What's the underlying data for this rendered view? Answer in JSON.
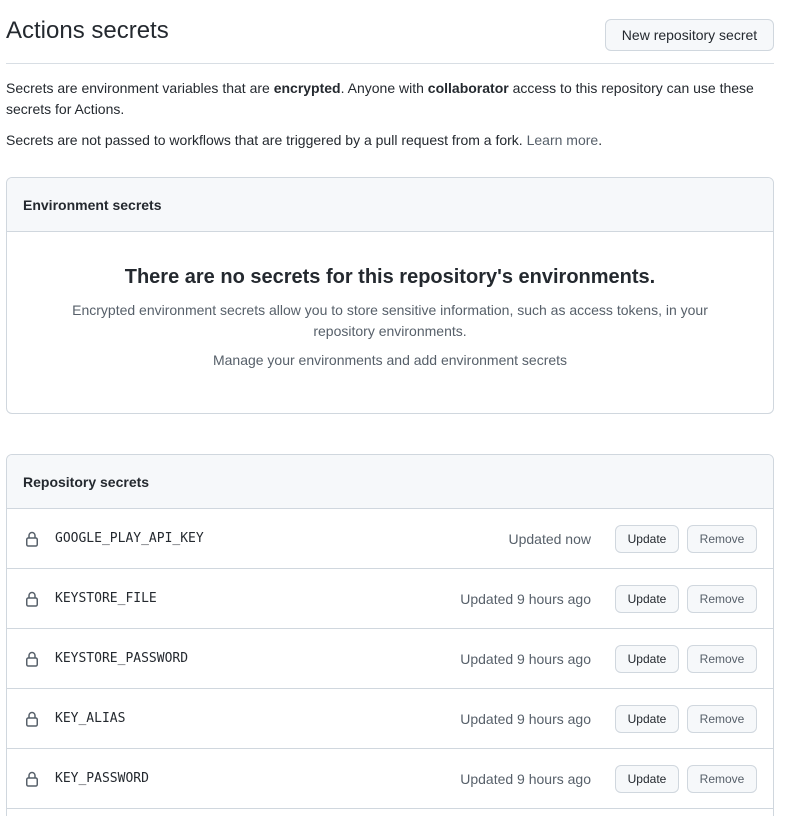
{
  "header": {
    "title": "Actions secrets",
    "new_secret_label": "New repository secret"
  },
  "description": {
    "line1_a": "Secrets are environment variables that are ",
    "line1_b": "encrypted",
    "line1_c": ". Anyone with ",
    "line1_d": "collaborator",
    "line1_e": " access to this repository can use these secrets for Actions.",
    "line2": "Secrets are not passed to workflows that are triggered by a pull request from a fork.",
    "learn_more": "Learn more",
    "line2_end": "."
  },
  "environment_secrets": {
    "header": "Environment secrets",
    "blank_title": "There are no secrets for this repository's environments.",
    "blank_text": "Encrypted environment secrets allow you to store sensitive information, such as access tokens, in your repository environments.",
    "manage_link": "Manage your environments and add environment secrets"
  },
  "repository_secrets": {
    "header": "Repository secrets",
    "update_label": "Update",
    "remove_label": "Remove",
    "items": [
      {
        "name": "GOOGLE_PLAY_API_KEY",
        "updated": "Updated now"
      },
      {
        "name": "KEYSTORE_FILE",
        "updated": "Updated 9 hours ago"
      },
      {
        "name": "KEYSTORE_PASSWORD",
        "updated": "Updated 9 hours ago"
      },
      {
        "name": "KEY_ALIAS",
        "updated": "Updated 9 hours ago"
      },
      {
        "name": "KEY_PASSWORD",
        "updated": "Updated 9 hours ago"
      }
    ]
  },
  "icons": {
    "row_icon": "lock-icon"
  },
  "colors": {
    "text": "#24292f",
    "muted": "#57606a",
    "border": "#d0d7de",
    "header_bg": "#f6f8fa"
  }
}
